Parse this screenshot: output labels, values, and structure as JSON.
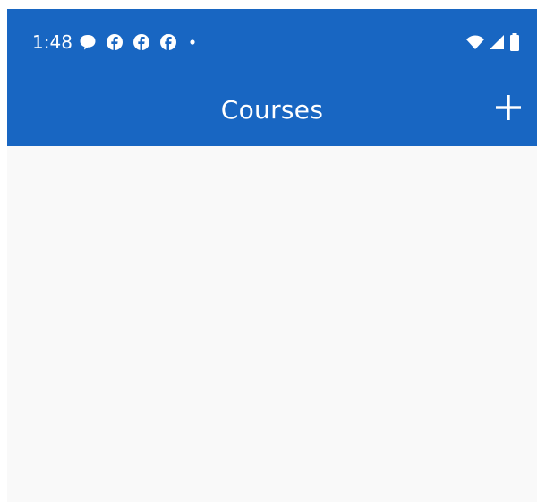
{
  "status_bar": {
    "time": "1:48",
    "left_icons": [
      "chat-bubble-icon",
      "facebook-icon",
      "facebook-icon",
      "facebook-icon",
      "dot-icon"
    ],
    "right_icons": [
      "wifi-icon",
      "cellular-signal-icon",
      "battery-icon"
    ]
  },
  "app_bar": {
    "title": "Courses",
    "add_icon": "plus-icon"
  },
  "colors": {
    "primary": "#1866c2",
    "background": "#f9f9f9",
    "on_primary": "#ffffff"
  }
}
